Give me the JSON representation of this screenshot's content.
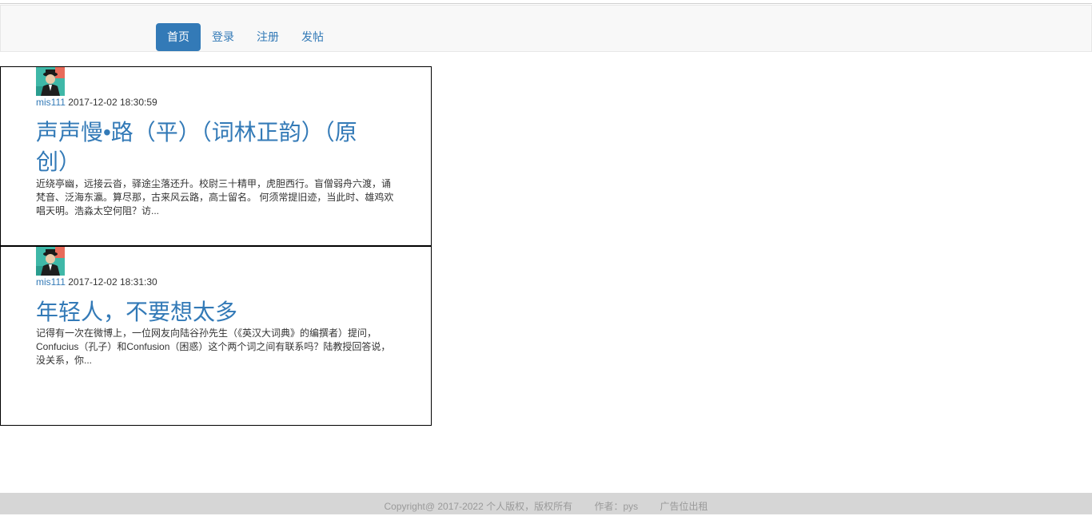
{
  "nav": {
    "items": [
      {
        "label": "首页",
        "active": true
      },
      {
        "label": "登录",
        "active": false
      },
      {
        "label": "注册",
        "active": false
      },
      {
        "label": "发帖",
        "active": false
      }
    ]
  },
  "posts": [
    {
      "author": "mis111",
      "datetime": "2017-12-02 18:30:59",
      "title": "声声慢•路（平）（词林正韵）（原创）",
      "excerpt": "近绕亭幽，远接云沓，驿途尘落还升。校尉三十精甲，虎胆西行。盲僧弱舟六渡，诵梵音、泛海东瀛。算尽那，古来风云路，高士留名。 何须常提旧迹，当此时、雄鸡欢唱天明。浩淼太空何阻？访..."
    },
    {
      "author": "mis111",
      "datetime": "2017-12-02 18:31:30",
      "title": "年轻人，不要想太多",
      "excerpt": "记得有一次在微博上，一位网友向陆谷孙先生（《英汉大词典》的编撰者）提问，Confucius（孔子）和Confusion（困惑）这个两个词之间有联系吗？陆教授回答说，没关系，你..."
    }
  ],
  "footer": {
    "copyright": "Copyright@ 2017-2022 个人版权，版权所有",
    "author": "作者：pys",
    "ad": "广告位出租"
  },
  "colors": {
    "accent": "#337ab7",
    "navbar_bg": "#f8f8f8",
    "footer_bg": "#d6d6d6"
  }
}
